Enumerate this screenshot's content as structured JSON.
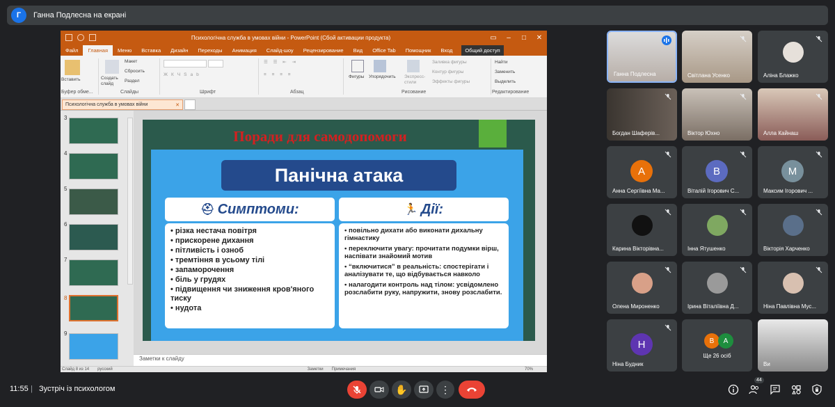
{
  "top_bar": {
    "presenter_initial": "Г",
    "presenter_text": "Ганна Подлесна на екрані"
  },
  "powerpoint": {
    "window_title": "Психологічна служба в умовах війни - PowerPoint (Сбой активации продукта)",
    "tabs": [
      "Файл",
      "Главная",
      "Меню",
      "Вставка",
      "Дизайн",
      "Переходы",
      "Анимация",
      "Слайд-шоу",
      "Рецензирование",
      "Вид",
      "Office Tab"
    ],
    "help": "Помощник",
    "signin": "Вход",
    "share": "Общий доступ",
    "ribbon": {
      "paste": "Вставить",
      "clipboard": "Буфер обме...",
      "new_slide": "Создать слайд",
      "layout": "Макет",
      "reset": "Сбросить",
      "section": "Раздел",
      "slides": "Слайды",
      "font": "Шрифт",
      "paragraph": "Абзац",
      "shapes": "Фигуры",
      "arrange": "Упорядочить",
      "quick_styles": "Экспресс-стили",
      "shape_fill": "Заливка фигуры",
      "shape_outline": "Контур фигуры",
      "shape_effects": "Эффекты фигуры",
      "drawing": "Рисование",
      "find": "Найти",
      "replace": "Заменить",
      "select": "Выделить",
      "editing": "Редактирование"
    },
    "doc_tab": "Психологічна служба в умовах війни",
    "thumb_numbers": [
      "3",
      "4",
      "5",
      "6",
      "7",
      "8",
      "9"
    ],
    "notes_placeholder": "Заметки к слайду",
    "status": {
      "slide": "Слайд 8 из 14",
      "lang": "русский",
      "notes": "Заметки",
      "comments": "Примечания",
      "zoom": "70%"
    }
  },
  "slide": {
    "title": "Поради для самодопомоги",
    "heading": "Панічна атака",
    "symptoms_header": "Симптоми:",
    "actions_header": "Дії:",
    "symptoms": [
      "різка нестача повітря",
      "прискорене дихання",
      "пітливість і озноб",
      "тремтіння в усьому тілі",
      "запаморочення",
      "біль у грудях",
      "підвищення чи зниження кров'яного тиску",
      "нудота"
    ],
    "actions": [
      "повільно дихати або виконати дихальну гімнастику",
      "переключити увагу: прочитати подумки вірш, наспівати знайомий мотив",
      "“включитися” в реальність: спостерігати і аналізувати те, що відбувається навколо",
      "налагодити контроль над тілом: усвідомлено розслабити руку, напружити, знову розслабити."
    ]
  },
  "participants": [
    {
      "name": "Ганна Подлесна",
      "speaking": true
    },
    {
      "name": "Світлана Усенко"
    },
    {
      "name": "Аліна Блажко"
    },
    {
      "name": "Богдан Шаферів..."
    },
    {
      "name": "Віктор Юхно"
    },
    {
      "name": "Алла Кайнаш"
    },
    {
      "name": "Анна Сергіївна Ма...",
      "initial": "А",
      "color": "#e8710a"
    },
    {
      "name": "Віталій Ігорович С...",
      "initial": "В",
      "color": "#5c6bc0"
    },
    {
      "name": "Максим Ігорович ...",
      "initial": "М",
      "color": "#78909c"
    },
    {
      "name": "Карина Вікторівна..."
    },
    {
      "name": "Інна Ятушенко"
    },
    {
      "name": "Вікторія Харченко"
    },
    {
      "name": "Олена Мироненко"
    },
    {
      "name": "Ірина Віталіївна Д..."
    },
    {
      "name": "Ніна Павлівна Мус..."
    },
    {
      "name": "Ніна Будник",
      "initial": "Н",
      "color": "#5e35b1"
    },
    {
      "name": "Ще 26 осіб",
      "initials": [
        "В",
        "А"
      ],
      "colors": [
        "#e8710a",
        "#1e8e3e"
      ]
    },
    {
      "name": "Ви"
    }
  ],
  "bottom_bar": {
    "time": "11:55",
    "separator": "|",
    "meeting_title": "Зустріч із психологом",
    "people_count": "44"
  },
  "colors": {
    "accent_red": "#ea4335",
    "ppt_orange": "#c55a11",
    "tile_bg": "#3c4043"
  }
}
